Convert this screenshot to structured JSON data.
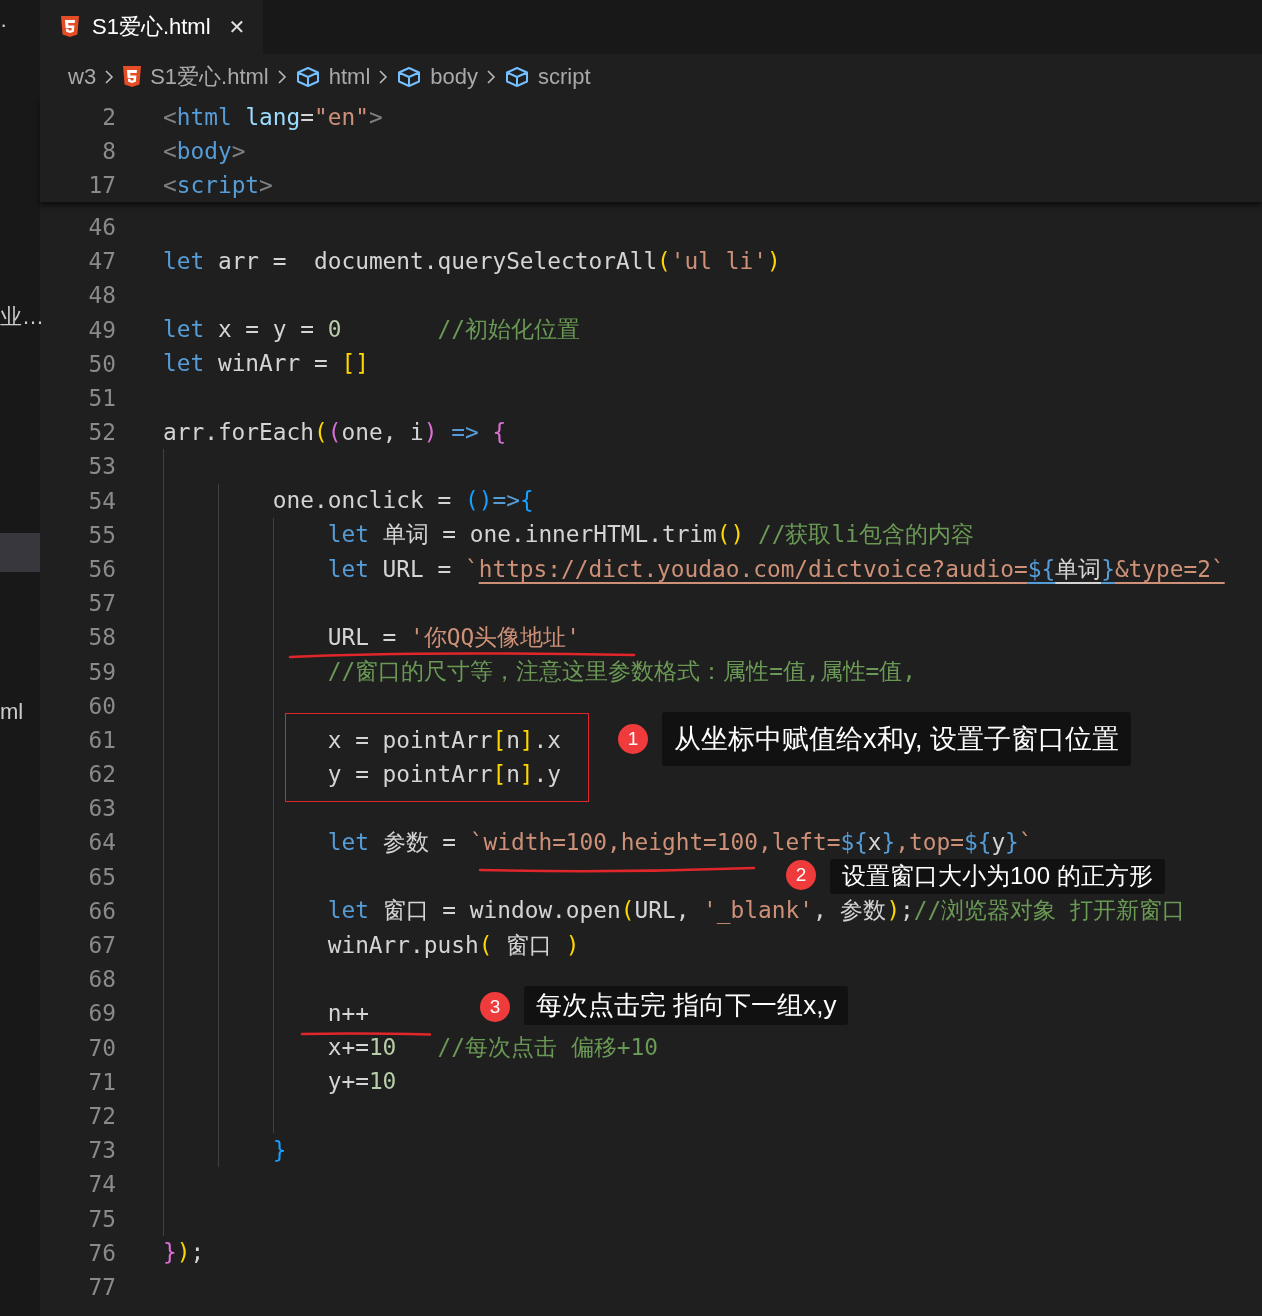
{
  "sidebar": {
    "items": [
      {
        "text": "·",
        "selected": false
      },
      {
        "text": "业…",
        "selected": false
      },
      {
        "selected": true
      },
      {
        "text": "ml",
        "selected": false
      }
    ]
  },
  "tabs": [
    {
      "label": "S1爱心.html",
      "selected": true,
      "close": "✕"
    }
  ],
  "breadcrumb": [
    {
      "kind": "folder",
      "label": "w3"
    },
    {
      "kind": "html-file",
      "label": "S1爱心.html"
    },
    {
      "kind": "element",
      "label": "html"
    },
    {
      "kind": "element",
      "label": "body"
    },
    {
      "kind": "element",
      "label": "script"
    }
  ],
  "sticky_lines": [
    {
      "number": "2",
      "text": "<html lang=\"en\">"
    },
    {
      "number": "8",
      "text": "<body>"
    },
    {
      "number": "17",
      "text": "<script>"
    }
  ],
  "lines": [
    {
      "number": "46"
    },
    {
      "number": "47",
      "text": "let arr =  document.querySelectorAll('ul li')"
    },
    {
      "number": "48"
    },
    {
      "number": "49",
      "text": "let x = y = 0       //初始化位置"
    },
    {
      "number": "50",
      "text": "let winArr = []"
    },
    {
      "number": "51"
    },
    {
      "number": "52",
      "text": "arr.forEach((one, i) => {"
    },
    {
      "number": "53"
    },
    {
      "number": "54",
      "text": "        one.onclick = ()=>{"
    },
    {
      "number": "55",
      "text": "            let 单词 = one.innerHTML.trim() //获取li包含的内容"
    },
    {
      "number": "56",
      "text": "            let URL = `https://dict.youdao.com/dictvoice?audio=${单词}&type=2`"
    },
    {
      "number": "57"
    },
    {
      "number": "58",
      "text": "            URL = '你QQ头像地址'"
    },
    {
      "number": "59",
      "text": "            //窗口的尺寸等，注意这里参数格式：属性=值,属性=值,"
    },
    {
      "number": "60"
    },
    {
      "number": "61",
      "text": "            x = pointArr[n].x"
    },
    {
      "number": "62",
      "text": "            y = pointArr[n].y"
    },
    {
      "number": "63"
    },
    {
      "number": "64",
      "text": "            let 参数 = `width=100,height=100,left=${x},top=${y}`"
    },
    {
      "number": "65"
    },
    {
      "number": "66",
      "text": "            let 窗口 = window.open(URL, '_blank', 参数);//浏览器对象 打开新窗口"
    },
    {
      "number": "67",
      "text": "            winArr.push( 窗口 )"
    },
    {
      "number": "68"
    },
    {
      "number": "69",
      "text": "            n++"
    },
    {
      "number": "70",
      "text": "            x+=10   //每次点击 偏移+10"
    },
    {
      "number": "71",
      "text": "            y+=10"
    },
    {
      "number": "72"
    },
    {
      "number": "73",
      "text": "        }"
    },
    {
      "number": "74"
    },
    {
      "number": "75"
    },
    {
      "number": "76",
      "text": "});"
    },
    {
      "number": "77"
    }
  ],
  "red_marks": [
    {
      "kind": "underline"
    },
    {
      "kind": "box"
    },
    {
      "kind": "underline"
    },
    {
      "kind": "underline"
    }
  ],
  "callouts": [
    {
      "number": "1",
      "text": "从坐标中赋值给x和y, 设置子窗口位置"
    },
    {
      "number": "2",
      "text": "设置窗口大小为100 的正方形"
    },
    {
      "number": "3",
      "text": "每次点击完 指向下一组x,y"
    }
  ]
}
